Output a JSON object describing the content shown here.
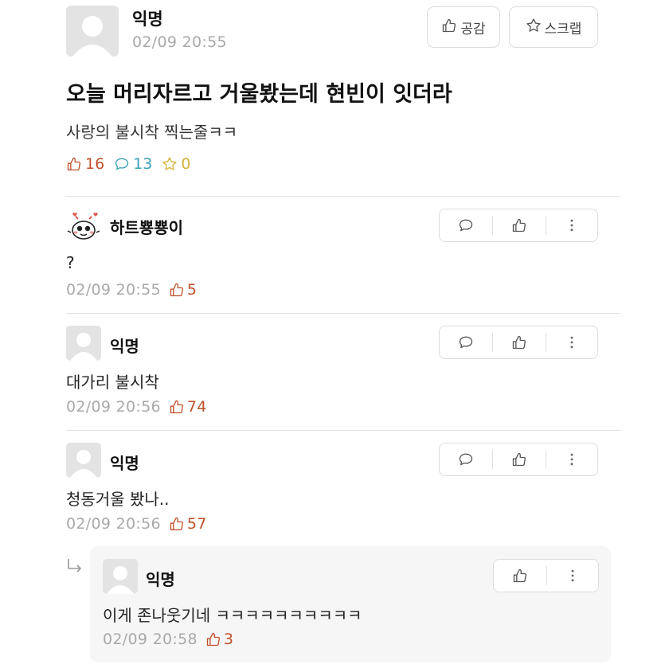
{
  "post": {
    "author": "익명",
    "time": "02/09 20:55",
    "like_button": "공감",
    "scrap_button": "스크랩",
    "title": "오늘 머리자르고 거울봤는데 현빈이 잇더라",
    "body": "사랑의 불시착 찍는줄ㅋㅋ",
    "likes": "16",
    "comments": "13",
    "scraps": "0"
  },
  "comments": [
    {
      "author": "하트뿅뿅이",
      "text": "?",
      "time": "02/09 20:55",
      "likes": "5"
    },
    {
      "author": "익명",
      "text": "대가리 불시착",
      "time": "02/09 20:56",
      "likes": "74"
    },
    {
      "author": "익명",
      "text": "청동거울 봤나..",
      "time": "02/09 20:56",
      "likes": "57"
    }
  ],
  "reply": {
    "author": "익명",
    "text": "이게 존나웃기네 ㅋㅋㅋㅋㅋㅋㅋㅋㅋㅋ",
    "time": "02/09 20:58",
    "likes": "3"
  },
  "colors": {
    "like": "#c0502a",
    "comment": "#3aa0b6",
    "scrap": "#d4b23a",
    "muted": "#a9a9a9",
    "border": "#dcdcdc"
  }
}
